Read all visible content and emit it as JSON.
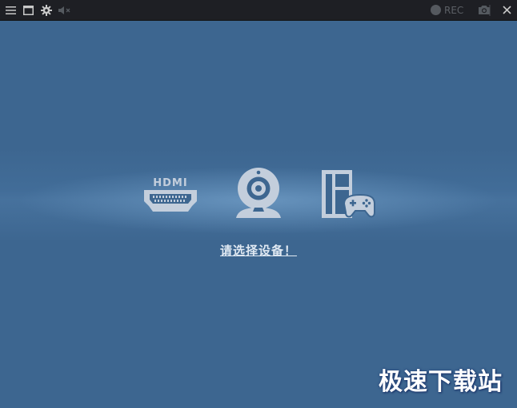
{
  "titlebar": {
    "rec_label": "REC",
    "icons": [
      "menu-icon",
      "window-icon",
      "gear-icon",
      "mute-icon",
      "record-icon",
      "camera-icon",
      "close-icon"
    ]
  },
  "devices": [
    {
      "name": "hdmi",
      "label": "HDMI"
    },
    {
      "name": "webcam",
      "label": ""
    },
    {
      "name": "console",
      "label": ""
    }
  ],
  "main": {
    "prompt": "请选择设备！"
  },
  "watermark": "极速下载站",
  "colors": {
    "background": "#3d6690",
    "titlebar": "#1e1f24",
    "icon": "#c3cedc",
    "prompt": "#dfe8f2"
  }
}
